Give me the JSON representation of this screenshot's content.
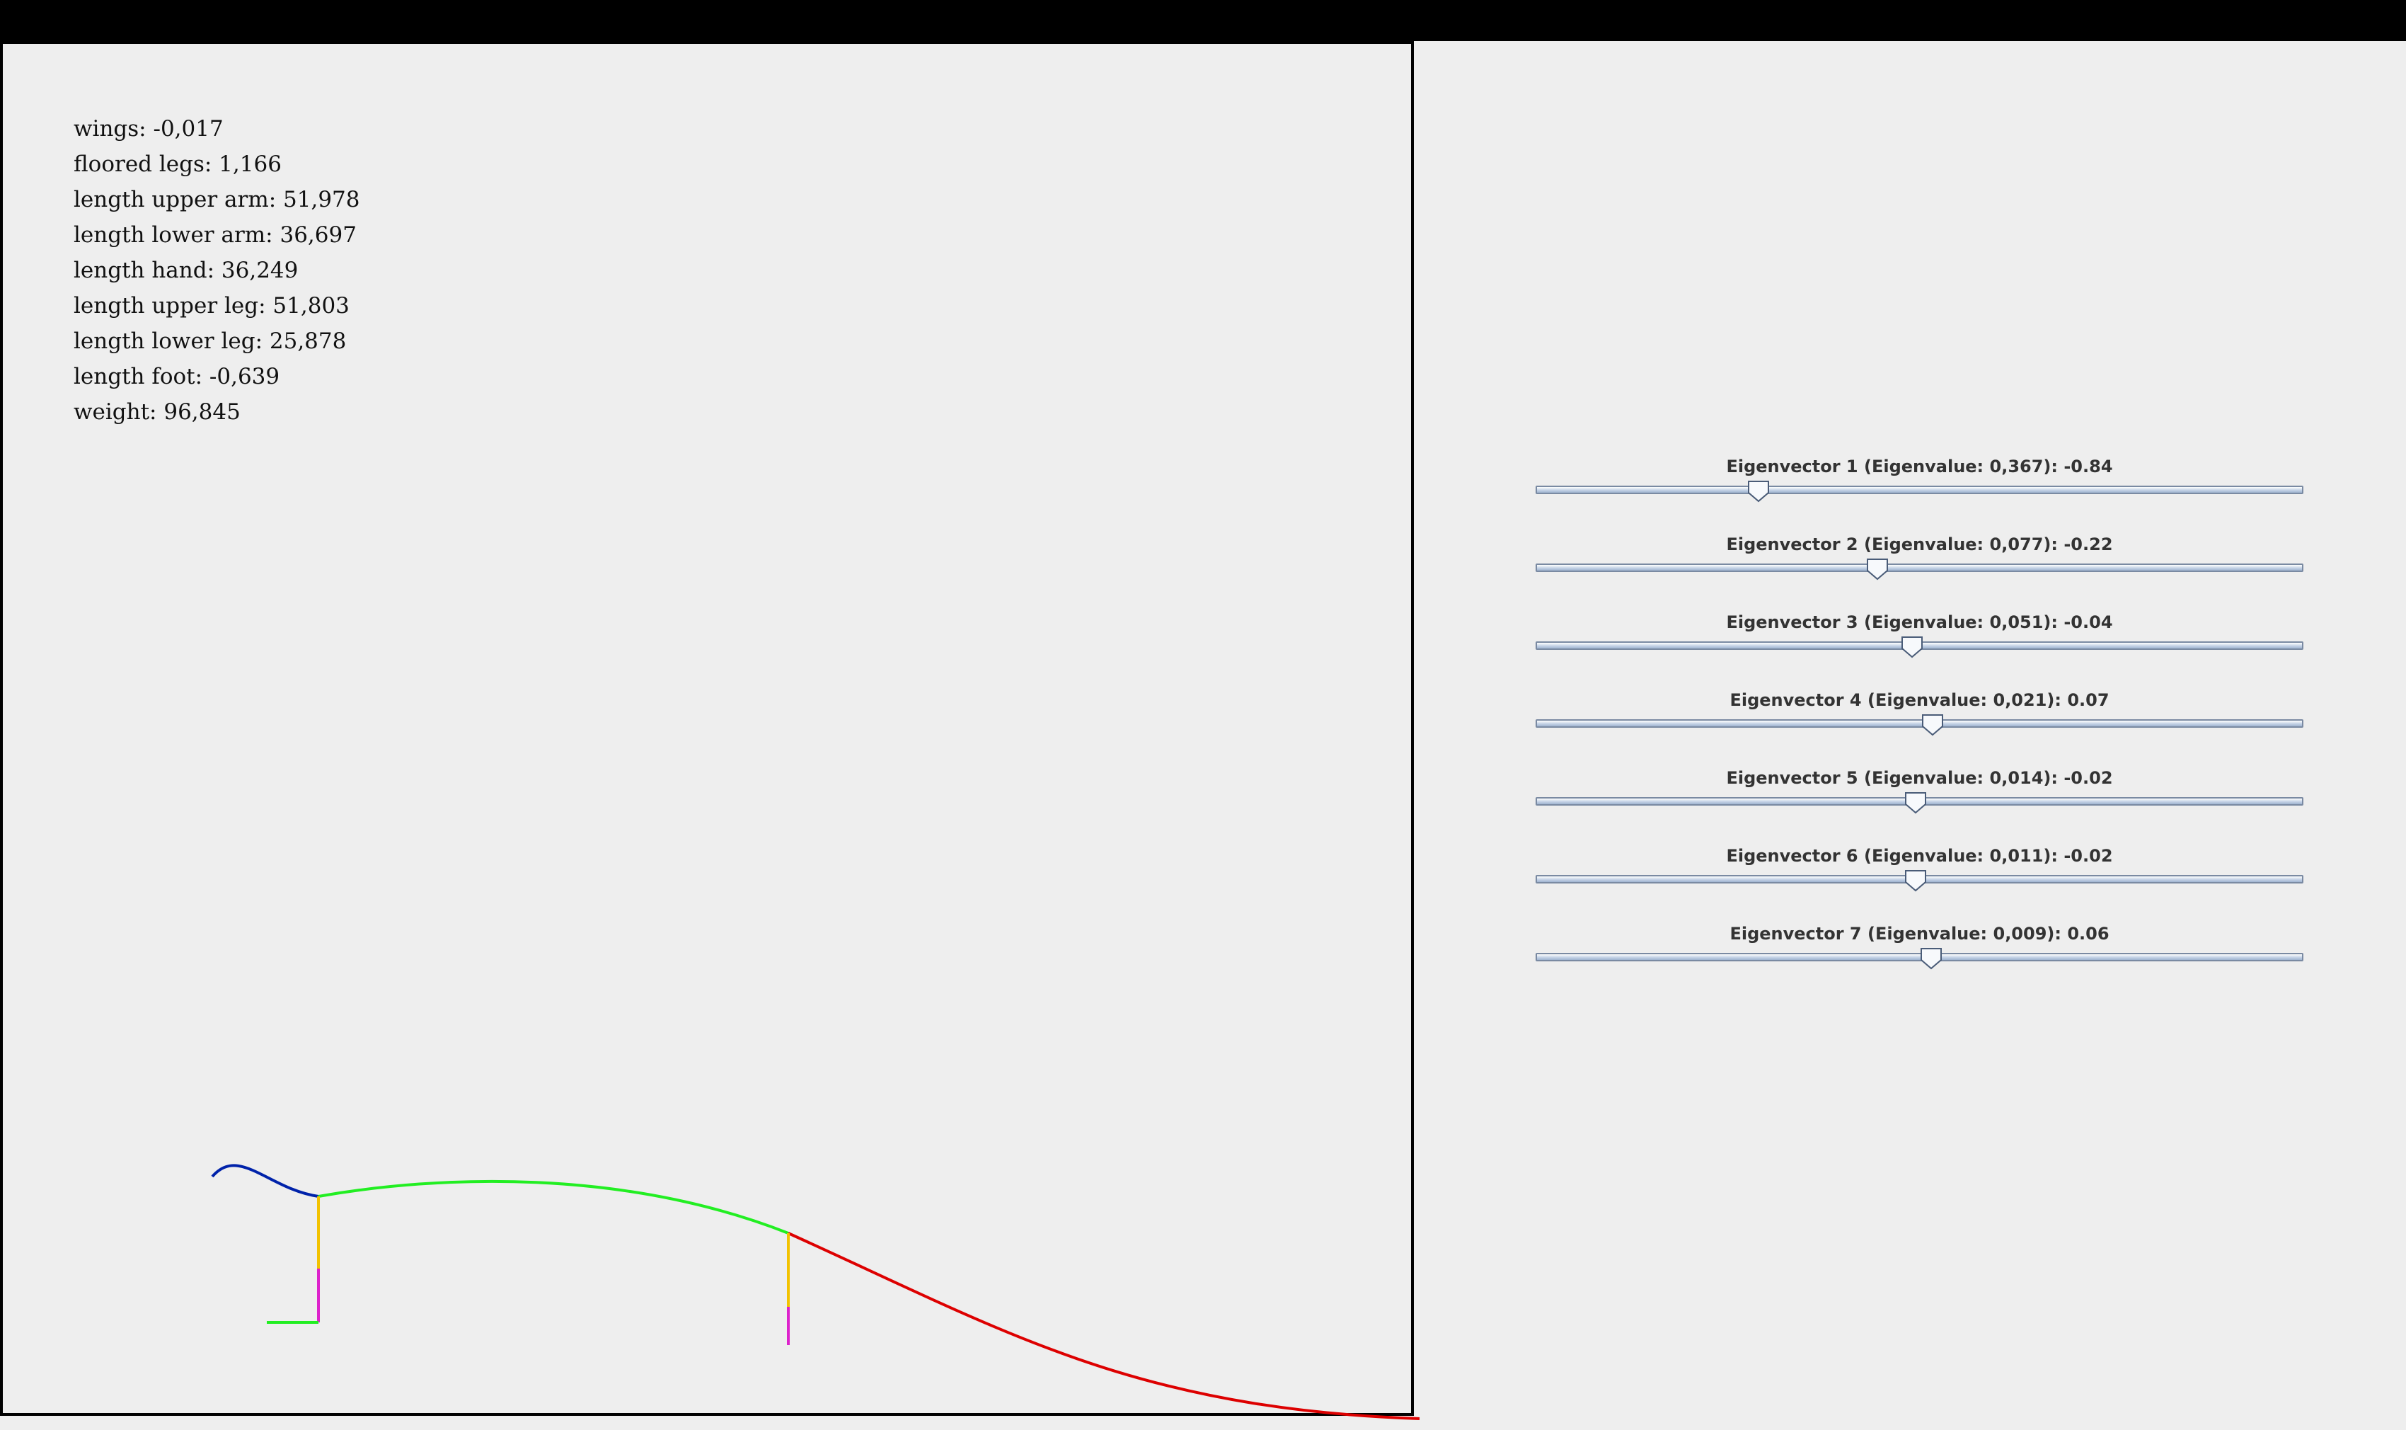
{
  "stats": [
    "wings: -0,017",
    "floored legs: 1,166",
    "length upper arm: 51,978",
    "length lower arm: 36,697",
    "length hand: 36,249",
    "length upper leg: 51,803",
    "length lower leg: 25,878",
    "length foot: -0,639",
    "weight: 96,845"
  ],
  "sliders": [
    {
      "label": "Eigenvector 1 (Eigenvalue: 0,367): -0.84",
      "value": -0.84
    },
    {
      "label": "Eigenvector 2 (Eigenvalue: 0,077): -0.22",
      "value": -0.22
    },
    {
      "label": "Eigenvector 3 (Eigenvalue: 0,051): -0.04",
      "value": -0.04
    },
    {
      "label": "Eigenvector 4 (Eigenvalue: 0,021): 0.07",
      "value": 0.07
    },
    {
      "label": "Eigenvector 5 (Eigenvalue: 0,014): -0.02",
      "value": -0.02
    },
    {
      "label": "Eigenvector 6 (Eigenvalue: 0,011): -0.02",
      "value": -0.02
    },
    {
      "label": "Eigenvector 7 (Eigenvalue: 0,009): 0.06",
      "value": 0.06
    }
  ],
  "slider_range": [
    -2,
    2
  ],
  "colors": {
    "head": "#0022aa",
    "spine": "#22ee22",
    "tail": "#dd0000",
    "upper_leg": "#f2c200",
    "lower_leg": "#dd22cc",
    "foot": "#22ee22"
  }
}
